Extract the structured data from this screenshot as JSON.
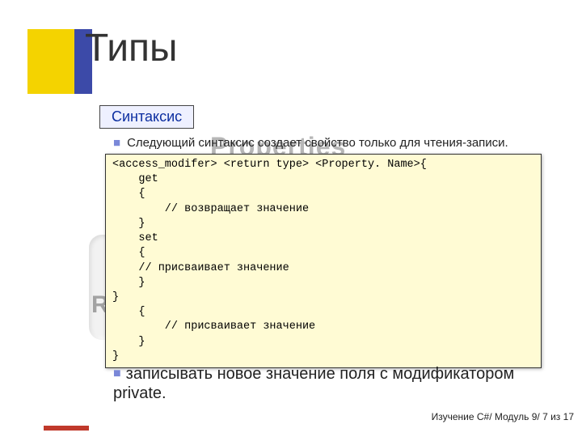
{
  "title": "Типы",
  "badge": "Синтаксис",
  "bullet": "Следующий синтаксис создает свойство только для чтения-записи.",
  "ghostTitle": "Properties",
  "ghostR": "R",
  "code": "<access_modifer> <return type> <Property. Name>{\n    get\n    {\n        // возвращает значение\n    }\n    set\n    {\n    // присваивает значение\n    }\n}\n    {\n        // присваивает значение\n    }\n}",
  "paragraph": "записывать новое значение поля с модификатором private.",
  "footer": "Изучение C#/ Модуль 9/ 7 из 17"
}
